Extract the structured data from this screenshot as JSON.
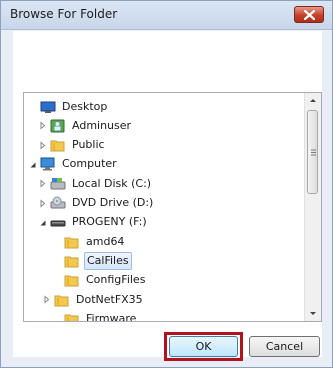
{
  "dialog": {
    "title": "Browse For Folder",
    "ok_label": "OK",
    "cancel_label": "Cancel",
    "highlight_color": "#b2121b"
  },
  "tree": {
    "items": [
      {
        "label": "Desktop",
        "icon": "desktop-icon",
        "expander": "none"
      },
      {
        "label": "Adminuser",
        "icon": "user-folder-icon",
        "expander": "collapsed"
      },
      {
        "label": "Public",
        "icon": "folder-icon",
        "expander": "collapsed"
      },
      {
        "label": "Computer",
        "icon": "computer-icon",
        "expander": "expanded"
      },
      {
        "label": "Local Disk (C:)",
        "icon": "hard-drive-icon",
        "expander": "collapsed"
      },
      {
        "label": "DVD Drive (D:)",
        "icon": "dvd-drive-icon",
        "expander": "collapsed"
      },
      {
        "label": "PROGENY (F:)",
        "icon": "removable-drive-icon",
        "expander": "expanded"
      },
      {
        "label": "amd64",
        "icon": "folder-icon",
        "expander": "none"
      },
      {
        "label": "CalFiles",
        "icon": "folder-icon",
        "expander": "none",
        "selected": true
      },
      {
        "label": "ConfigFiles",
        "icon": "folder-icon",
        "expander": "none"
      },
      {
        "label": "DotNetFX35",
        "icon": "folder-icon",
        "expander": "collapsed"
      },
      {
        "label": "Firmware",
        "icon": "folder-icon",
        "expander": "none"
      }
    ]
  }
}
